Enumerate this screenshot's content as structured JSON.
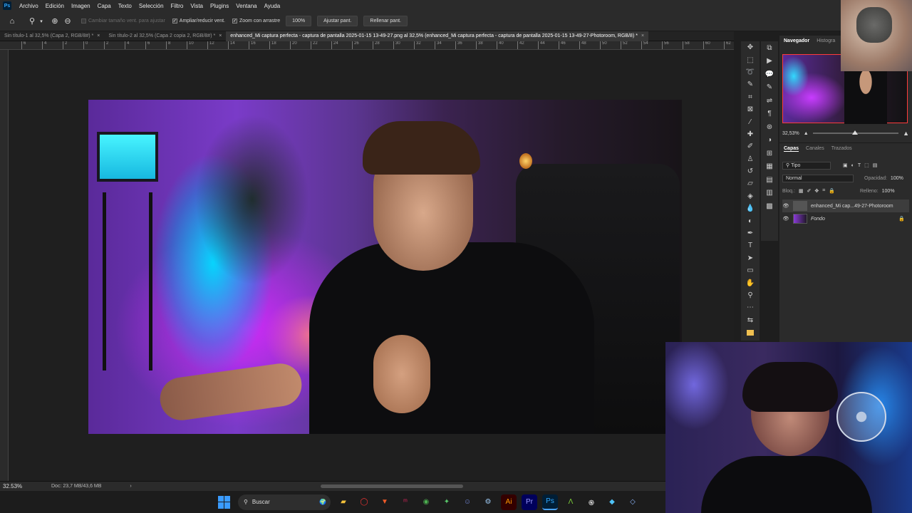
{
  "app": {
    "logo": "Ps"
  },
  "menu": [
    "Archivo",
    "Edición",
    "Imagen",
    "Capa",
    "Texto",
    "Selección",
    "Filtro",
    "Vista",
    "Plugins",
    "Ventana",
    "Ayuda"
  ],
  "options": {
    "checkbox_resize": "Cambiar tamaño vent. para ajustar",
    "checkbox_zoom_all": "Ampliar/reducir vent.",
    "checkbox_scrubby": "Zoom con arrastre",
    "zoom_value": "100%",
    "fit_button": "Ajustar pant.",
    "fill_button": "Rellenar pant."
  },
  "tabs": [
    {
      "label": "Sin título-1 al 32,5% (Capa 2, RGB/8#) *"
    },
    {
      "label": "Sin título-2 al 32,5% (Capa 2 copia 2, RGB/8#) *"
    },
    {
      "label": "enhanced_Mi captura perfecta - captura de pantalla 2025-01-15 13-49-27.png al 32,5% (enhanced_Mi captura perfecta - captura de pantalla 2025-01-15 13-49-27-Photoroom, RGB/8) *"
    }
  ],
  "ruler_ticks": [
    "6",
    "4",
    "2",
    "0",
    "2",
    "4",
    "6",
    "8",
    "10",
    "12",
    "14",
    "16",
    "18",
    "20",
    "22",
    "24",
    "26",
    "28",
    "30",
    "32",
    "34",
    "36",
    "38",
    "40",
    "42",
    "44",
    "46",
    "48",
    "50",
    "52",
    "54",
    "56",
    "58",
    "60",
    "62"
  ],
  "panels": {
    "navigator_tab": "Navegador",
    "histogram_tab": "Histogra",
    "zoom": "32,53%",
    "layers_tab": "Capas",
    "channels_tab": "Canales",
    "paths_tab": "Trazados",
    "kind_filter": "Tipo",
    "blend_mode": "Normal",
    "opacity_label": "Opacidad:",
    "opacity_value": "100%",
    "lock_label": "Bloq.:",
    "fill_label": "Relleno:",
    "fill_value": "100%",
    "layers": [
      {
        "name": "enhanced_Mi cap...49-27-Photoroom"
      },
      {
        "name": "Fondo"
      }
    ]
  },
  "status": {
    "zoom": "32.53%",
    "doc": "Doc: 23,7 MB/43,6 MB"
  },
  "taskbar": {
    "search_placeholder": "Buscar"
  }
}
